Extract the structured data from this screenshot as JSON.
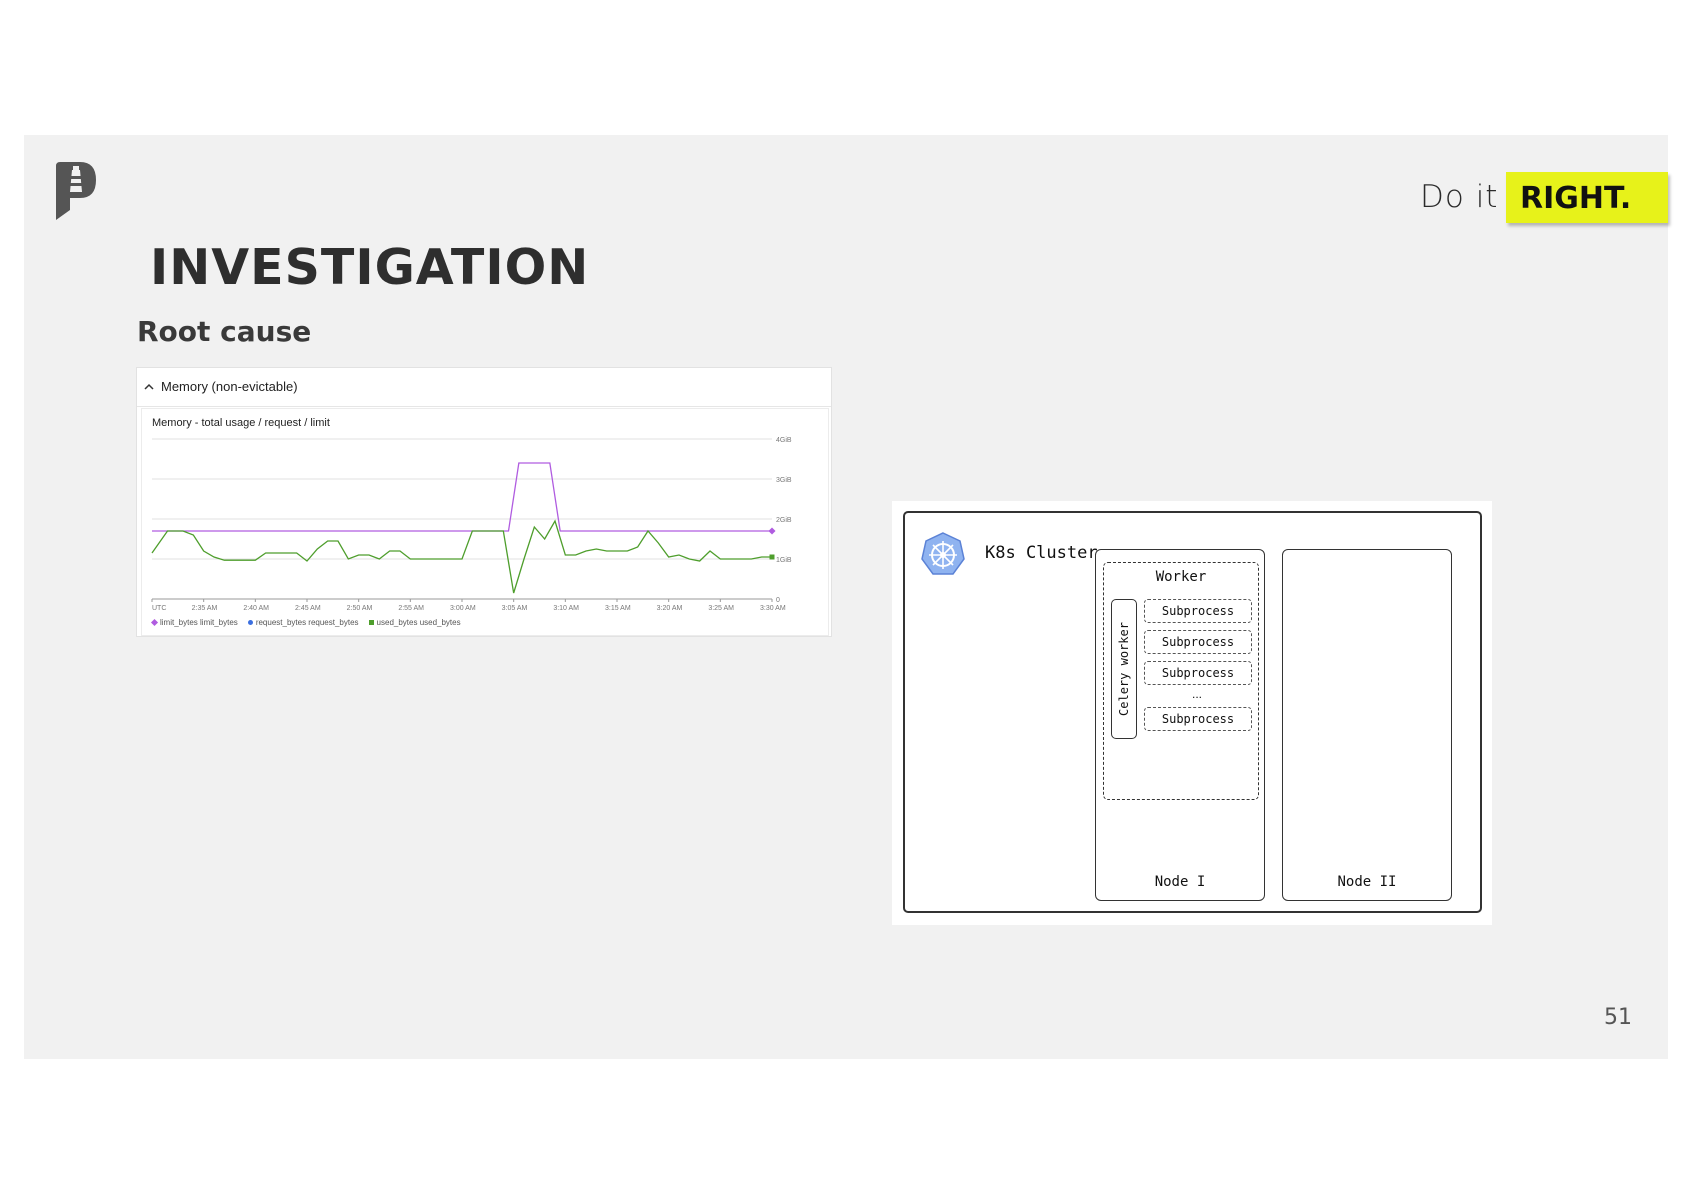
{
  "slide": {
    "tagline_text": "Do it",
    "tagline_strong": "RIGHT.",
    "title": "INVESTIGATION",
    "subtitle": "Root cause",
    "page_number": "51",
    "accent_color": "#e7f21a"
  },
  "monitoring_panel": {
    "panel_title": "Memory (non-evictable)",
    "collapse_icon": "chevron-up-icon",
    "chart_title": "Memory - total usage / request / limit",
    "legend": [
      {
        "label": "limit_bytes limit_bytes",
        "color": "#b05ce0",
        "shape": "diamond"
      },
      {
        "label": "request_bytes request_bytes",
        "color": "#3b6fe0",
        "shape": "circle"
      },
      {
        "label": "used_bytes used_bytes",
        "color": "#4e9e2c",
        "shape": "square"
      }
    ]
  },
  "chart_data": {
    "type": "line",
    "title": "Memory - total usage / request / limit",
    "x_ticks": [
      "UTC",
      "2:35 AM",
      "2:40 AM",
      "2:45 AM",
      "2:50 AM",
      "2:55 AM",
      "3:00 AM",
      "3:05 AM",
      "3:10 AM",
      "3:15 AM",
      "3:20 AM",
      "3:25 AM",
      "3:30 AM"
    ],
    "y_ticks": [
      "0",
      "1GiB",
      "2GiB",
      "3GiB",
      "4GiB"
    ],
    "ylim": [
      0,
      4
    ],
    "xlim": [
      0,
      60
    ],
    "series": [
      {
        "name": "limit_bytes limit_bytes",
        "color": "#b05ce0",
        "x": [
          0,
          34.5,
          35.5,
          38.5,
          39.5,
          60
        ],
        "y": [
          1.7,
          1.7,
          3.4,
          3.4,
          1.7,
          1.7
        ]
      },
      {
        "name": "used_bytes used_bytes",
        "color": "#4e9e2c",
        "x": [
          0,
          1.5,
          3,
          4,
          5,
          6,
          7,
          8,
          9,
          10,
          11,
          12,
          13,
          14,
          15,
          16,
          17,
          18,
          19,
          20,
          21,
          22,
          23,
          24,
          25,
          26,
          27,
          28,
          29,
          30,
          31,
          32,
          33,
          34,
          35,
          36,
          37,
          38,
          39,
          40,
          41,
          42,
          43,
          44,
          45,
          46,
          47,
          48,
          49,
          50,
          51,
          52,
          53,
          54,
          55,
          56,
          57,
          58,
          59,
          60
        ],
        "y": [
          1.15,
          1.7,
          1.7,
          1.6,
          1.2,
          1.05,
          0.97,
          0.97,
          0.97,
          0.97,
          1.15,
          1.15,
          1.15,
          1.15,
          0.95,
          1.25,
          1.45,
          1.45,
          1.0,
          1.1,
          1.1,
          1.0,
          1.2,
          1.2,
          1.0,
          1.0,
          1.0,
          1.0,
          1.0,
          1.0,
          1.7,
          1.7,
          1.7,
          1.7,
          0.15,
          1.0,
          1.8,
          1.5,
          1.95,
          1.1,
          1.1,
          1.2,
          1.25,
          1.2,
          1.2,
          1.2,
          1.3,
          1.7,
          1.4,
          1.05,
          1.1,
          1.0,
          0.95,
          1.2,
          1.0,
          1.0,
          1.0,
          1.0,
          1.05,
          1.05
        ]
      }
    ],
    "grid": true,
    "y_axis_side": "right",
    "legend_position": "bottom-left"
  },
  "diagram": {
    "cluster_label": "K8s Cluster",
    "cluster_icon": "kubernetes-icon",
    "nodes": [
      {
        "label": "Node I",
        "worker": {
          "label": "Worker",
          "celery_label": "Celery worker",
          "subprocesses": [
            "Subprocess",
            "Subprocess",
            "Subprocess",
            "Subprocess"
          ],
          "ellipsis": "..."
        }
      },
      {
        "label": "Node II"
      }
    ]
  }
}
